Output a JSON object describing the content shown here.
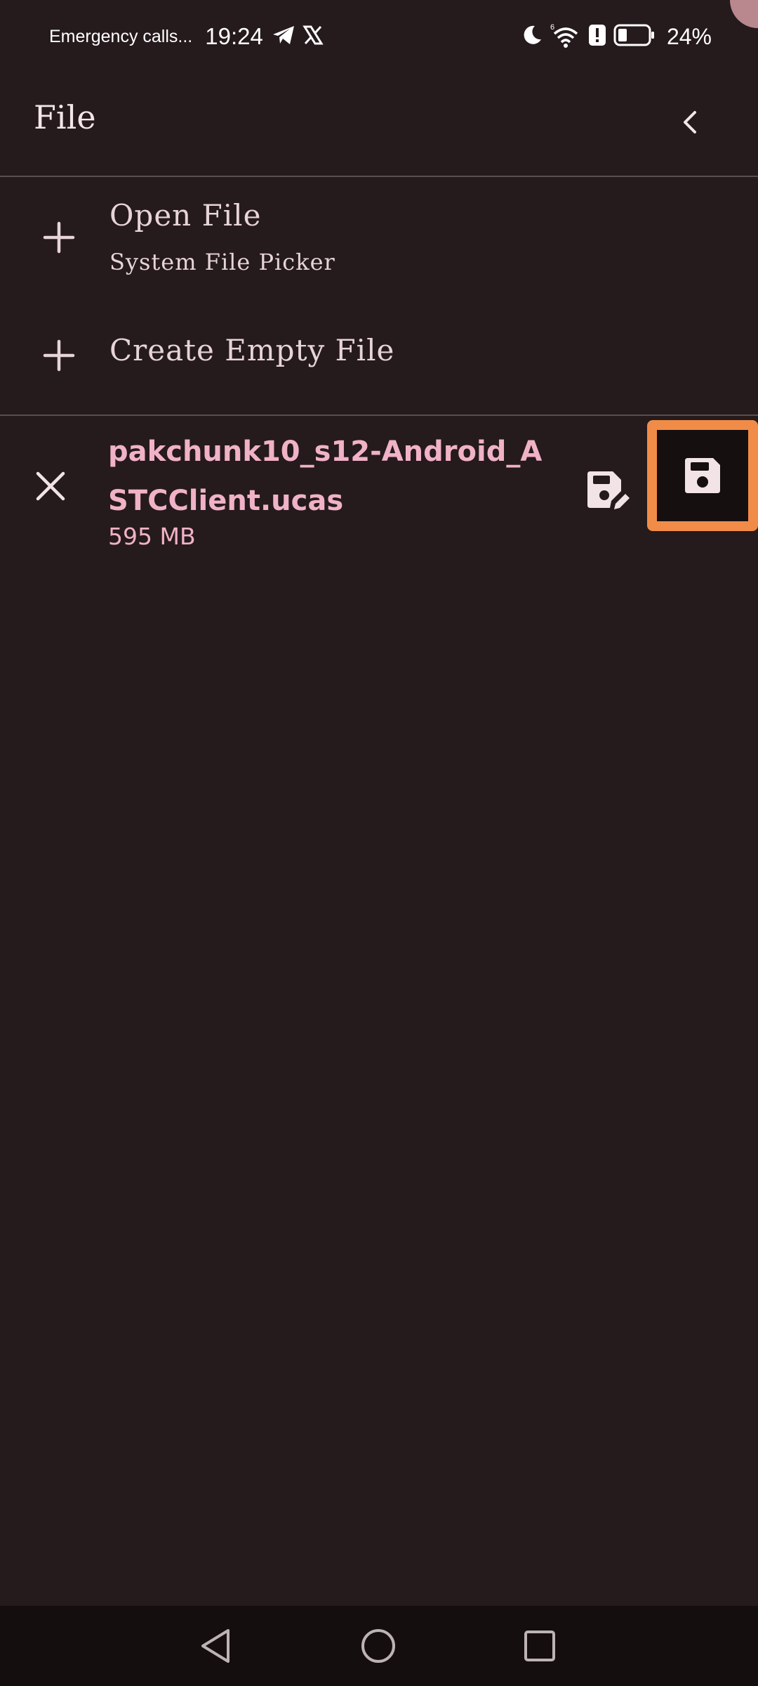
{
  "status_bar": {
    "carrier": "Emergency calls...",
    "time": "19:24",
    "battery": "24%",
    "icons_left": [
      "telegram-icon",
      "x-icon"
    ],
    "icons_right": [
      "moon-icon",
      "wifi-icon",
      "alert-icon",
      "battery-icon"
    ]
  },
  "app_bar": {
    "title": "File",
    "back_icon": "chevron-left-icon"
  },
  "menu": {
    "open_file": {
      "title": "Open File",
      "subtitle": "System File Picker",
      "icon": "plus-icon"
    },
    "create_file": {
      "title": "Create Empty File",
      "icon": "plus-icon"
    }
  },
  "file": {
    "name": "pakchunk10_s12-Android_ASTCClient.ucas",
    "size": "595 MB",
    "close_icon": "close-icon",
    "save_as_icon": "save-as-icon",
    "save_icon": "save-icon"
  },
  "colors": {
    "background": "#251a1c",
    "file_text": "#f0b2c6",
    "highlight": "#f08c48"
  },
  "nav_bar": {
    "icons": [
      "back-triangle-icon",
      "home-circle-icon",
      "recents-square-icon"
    ]
  }
}
